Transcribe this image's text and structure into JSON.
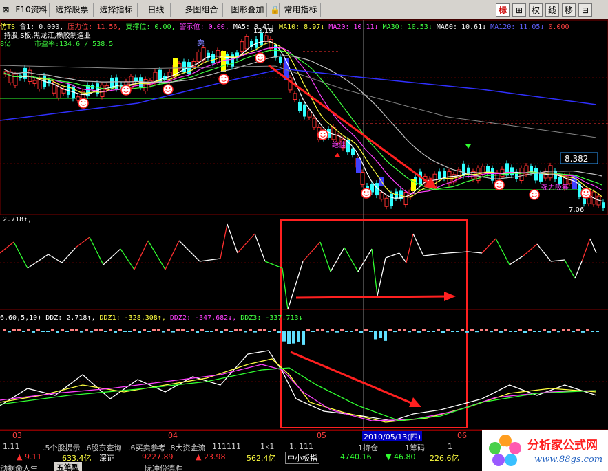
{
  "toolbar": {
    "buttons": [
      "F10资料",
      "选择股票",
      "选择指标",
      "日线",
      "多图组合",
      "图形叠加",
      "常用指标"
    ],
    "tools": [
      "标",
      "⊞",
      "权",
      "线",
      "移",
      "⊟"
    ]
  },
  "main_panel": {
    "stock_name": "仿TS",
    "indicators": [
      {
        "label": "合1: 0.000,",
        "color": "#ffffff"
      },
      {
        "label": "压力位: 11.56,",
        "color": "#ff4040"
      },
      {
        "label": "支撑位: 0.00,",
        "color": "#40ff40"
      },
      {
        "label": "警示位: 0.00,",
        "color": "#ff40ff"
      },
      {
        "label": "MA5: 8.41↓",
        "color": "#ffffff"
      },
      {
        "label": "MA10: 8.97↓",
        "color": "#ffff40"
      },
      {
        "label": "MA20: 10.11↓",
        "color": "#ff40ff"
      },
      {
        "label": "MA30: 10.53↓",
        "color": "#40ff40"
      },
      {
        "label": "MA60: 10.61↓",
        "color": "#ffffff"
      },
      {
        "label": "MA120: 11.05↓",
        "color": "#6060ff"
      },
      {
        "label": "0.000",
        "color": "#ff4040"
      }
    ],
    "info_line": "II持股,S板,黑龙江,橡胶制造业",
    "cap_prefix": "8亿",
    "pe_label": "市盈率:134.6 / 538.5",
    "high_label": "12.19",
    "low_label": "7.06",
    "price_tag": "8.382",
    "tag_sell": "卖",
    "tag_buy": "绝佳",
    "tag_absorb": "强力吸筹"
  },
  "sub_panel_1": {
    "label": "2.718↑,"
  },
  "sub_panel_2": {
    "prefix": "6,60,5,10)",
    "items": [
      {
        "label": "DDZ: 2.718↑,",
        "color": "#ffffff"
      },
      {
        "label": "DDZ1: -328.308↑,",
        "color": "#ffff40"
      },
      {
        "label": "DDZ2: -347.682↓,",
        "color": "#ff40ff"
      },
      {
        "label": "DDZ3: -337.713↓",
        "color": "#40ff40"
      }
    ]
  },
  "date_axis": {
    "months": [
      "03",
      "04",
      "05",
      "06"
    ],
    "cursor_date": "2010/05/13(四)"
  },
  "status_bar": {
    "row1": [
      "1.11",
      ".5个股提示",
      ".6股东查询",
      ".6买卖参考",
      ".8大资金流",
      "111111",
      "1k1",
      "1. 111",
      "1持仓",
      "1筹码",
      "1"
    ],
    "index1_value": "▲ 9.11",
    "index1_amount": "633.4亿",
    "index1_name": "深证",
    "index2_value": "9227.89",
    "index2_change": "▲ 23.98",
    "index2_amount": "562.4亿",
    "index3_name": "中小板指",
    "index3_value": "4740.16",
    "index3_change": "▼ 46.80",
    "index3_amount": "226.6亿",
    "row3_left": "动据命人生",
    "row3_btn": "五笔型",
    "row3_right": "际冲份德胜"
  },
  "watermark": {
    "title": "分析家公式网",
    "url": "www.88gs.com"
  },
  "colors": {
    "up": "#ff3030",
    "down": "#30ffff",
    "ma5": "#ffffff",
    "ma10": "#ffff40",
    "ma20": "#ff40ff",
    "ma30": "#40ff40",
    "ma60": "#c0c0c0",
    "ma120": "#3030ff"
  }
}
